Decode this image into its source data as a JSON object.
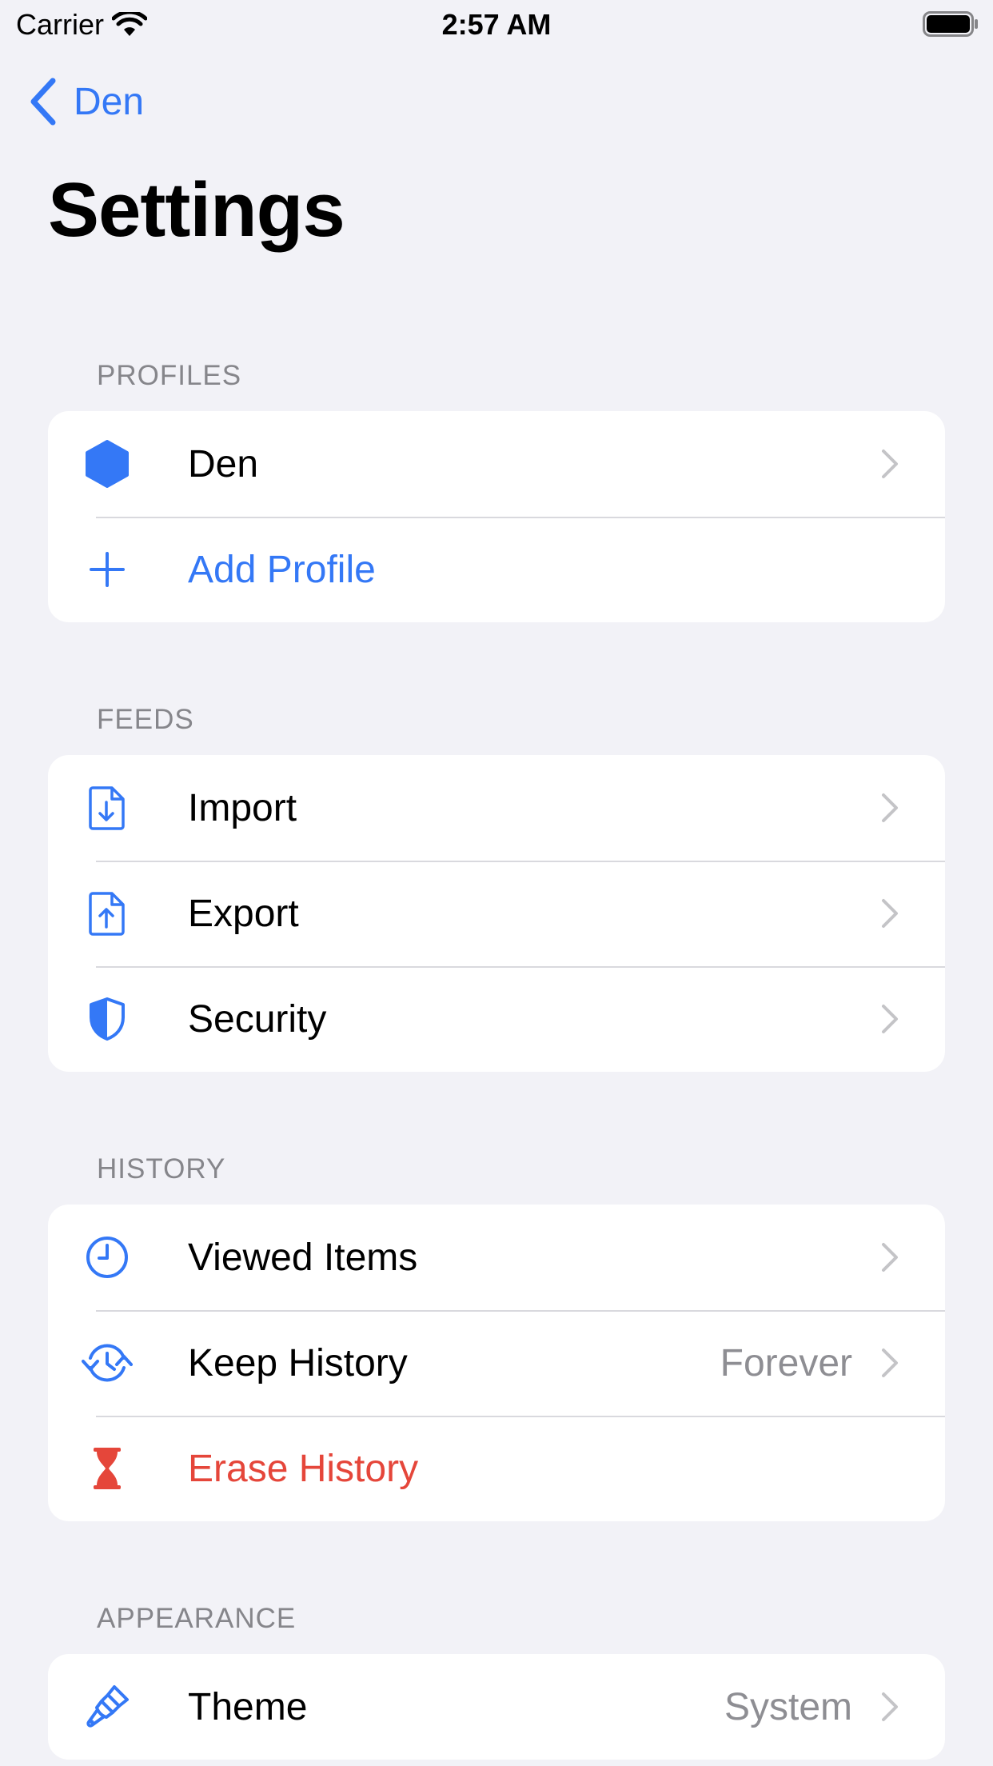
{
  "status_bar": {
    "carrier": "Carrier",
    "time": "2:57 AM"
  },
  "nav": {
    "back_label": "Den",
    "title": "Settings"
  },
  "colors": {
    "accent": "#3478f6",
    "destructive": "#e5463a",
    "secondary_text": "#8e8e93",
    "background": "#f2f2f7"
  },
  "sections": {
    "profiles": {
      "header": "PROFILES",
      "items": [
        {
          "label": "Den",
          "icon": "hexagon-icon"
        },
        {
          "label": "Add Profile",
          "icon": "plus-icon"
        }
      ]
    },
    "feeds": {
      "header": "FEEDS",
      "items": [
        {
          "label": "Import",
          "icon": "document-import-icon"
        },
        {
          "label": "Export",
          "icon": "document-export-icon"
        },
        {
          "label": "Security",
          "icon": "shield-icon"
        }
      ]
    },
    "history": {
      "header": "HISTORY",
      "items": [
        {
          "label": "Viewed Items",
          "icon": "clock-icon"
        },
        {
          "label": "Keep History",
          "value": "Forever",
          "icon": "clock-arrows-icon"
        },
        {
          "label": "Erase History",
          "icon": "hourglass-icon"
        }
      ]
    },
    "appearance": {
      "header": "APPEARANCE",
      "items": [
        {
          "label": "Theme",
          "value": "System",
          "icon": "paintbrush-icon"
        }
      ]
    }
  }
}
